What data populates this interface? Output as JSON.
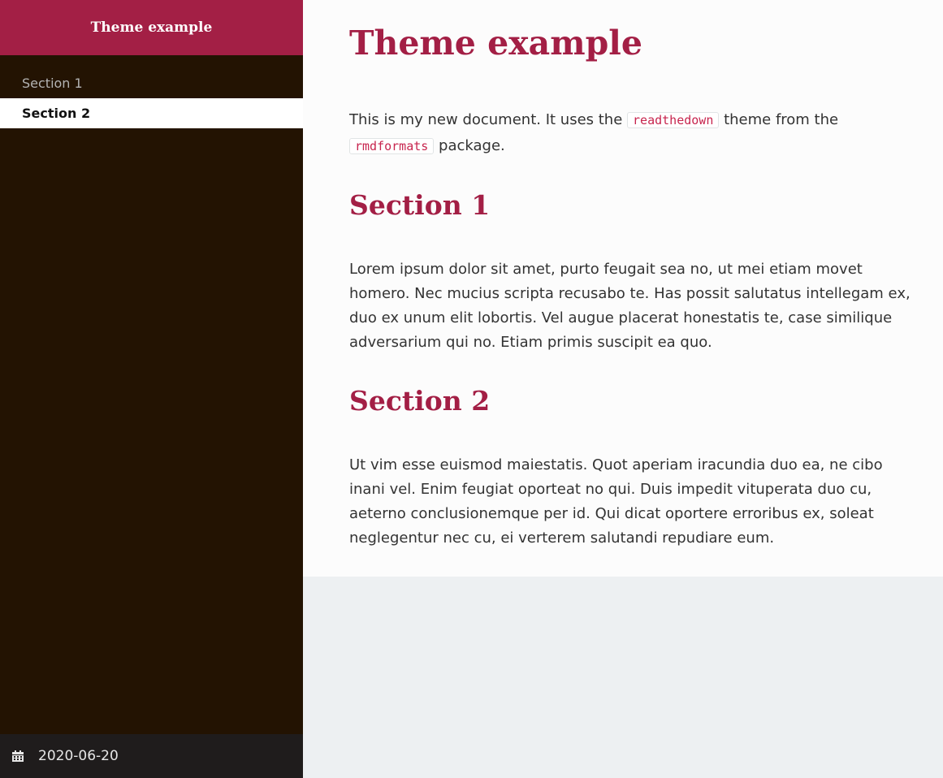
{
  "sidebar": {
    "title": "Theme example",
    "toc": [
      {
        "label": "Section 1",
        "active": false
      },
      {
        "label": "Section 2",
        "active": true
      }
    ],
    "date": "2020-06-20",
    "date_icon": "calendar-icon"
  },
  "main": {
    "title": "Theme example",
    "intro": {
      "before_code1": "This is my new document. It uses the ",
      "code1": "readthedown",
      "between": " theme from the ",
      "code2": "rmdformats",
      "after_code2": " package."
    },
    "sections": [
      {
        "title": "Section 1",
        "text": "Lorem ipsum dolor sit amet, purto feugait sea no, ut mei etiam movet homero. Nec mucius scripta recusabo te. Has possit salutatus intellegam ex, duo ex unum elit lobortis. Vel augue placerat honestatis te, case similique adversarium qui no. Etiam primis suscipit ea quo."
      },
      {
        "title": "Section 2",
        "text": "Ut vim esse euismod maiestatis. Quot aperiam iracundia duo ea, ne cibo inani vel. Enim feugiat oporteat no qui. Duis impedit vituperata duo cu, aeterno conclusionemque per id. Qui dicat oportere erroribus ex, soleat neglegentur nec cu, ei verterem salutandi repudiare eum."
      }
    ]
  },
  "colors": {
    "accent": "#a31f45",
    "sidebar_bg": "#231302",
    "footer_bg": "#1f1c1c",
    "content_bg": "#fcfcfc",
    "page_bg": "#edf0f2",
    "code_color": "#c7254e"
  }
}
